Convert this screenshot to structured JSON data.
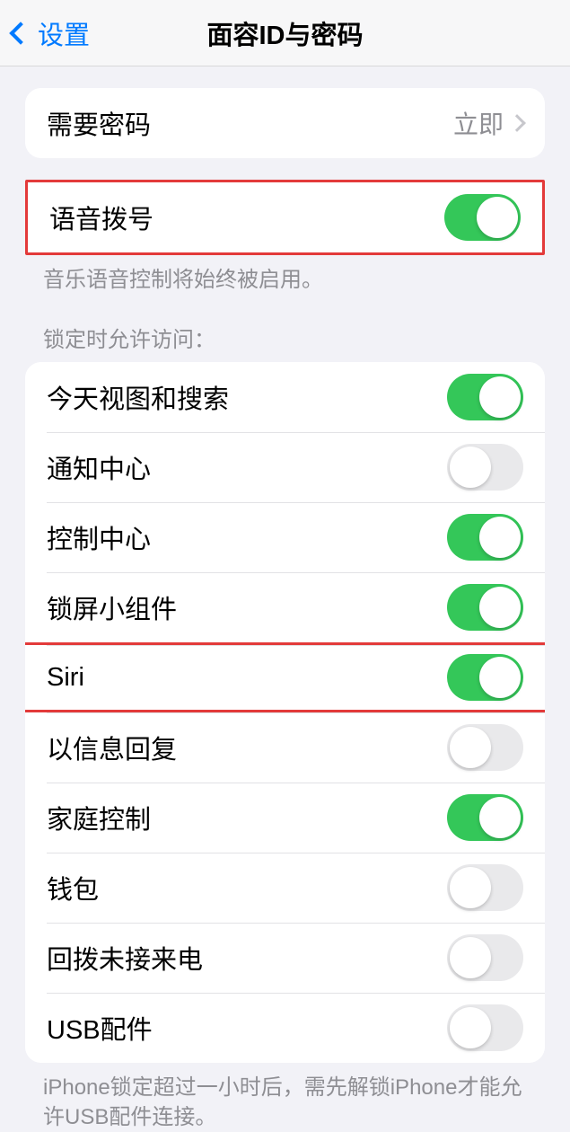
{
  "nav": {
    "back_label": "设置",
    "title": "面容ID与密码"
  },
  "passcode": {
    "require_label": "需要密码",
    "require_value": "立即"
  },
  "voice_dial": {
    "label": "语音拨号",
    "footer": "音乐语音控制将始终被启用。",
    "on": true
  },
  "locked_access": {
    "header": "锁定时允许访问：",
    "items": [
      {
        "label": "今天视图和搜索",
        "on": true
      },
      {
        "label": "通知中心",
        "on": false
      },
      {
        "label": "控制中心",
        "on": true
      },
      {
        "label": "锁屏小组件",
        "on": true
      },
      {
        "label": "Siri",
        "on": true
      },
      {
        "label": "以信息回复",
        "on": false
      },
      {
        "label": "家庭控制",
        "on": true
      },
      {
        "label": "钱包",
        "on": false
      },
      {
        "label": "回拨未接来电",
        "on": false
      },
      {
        "label": "USB配件",
        "on": false
      }
    ],
    "footer": "iPhone锁定超过一小时后，需先解锁iPhone才能允许USB配件连接。"
  }
}
